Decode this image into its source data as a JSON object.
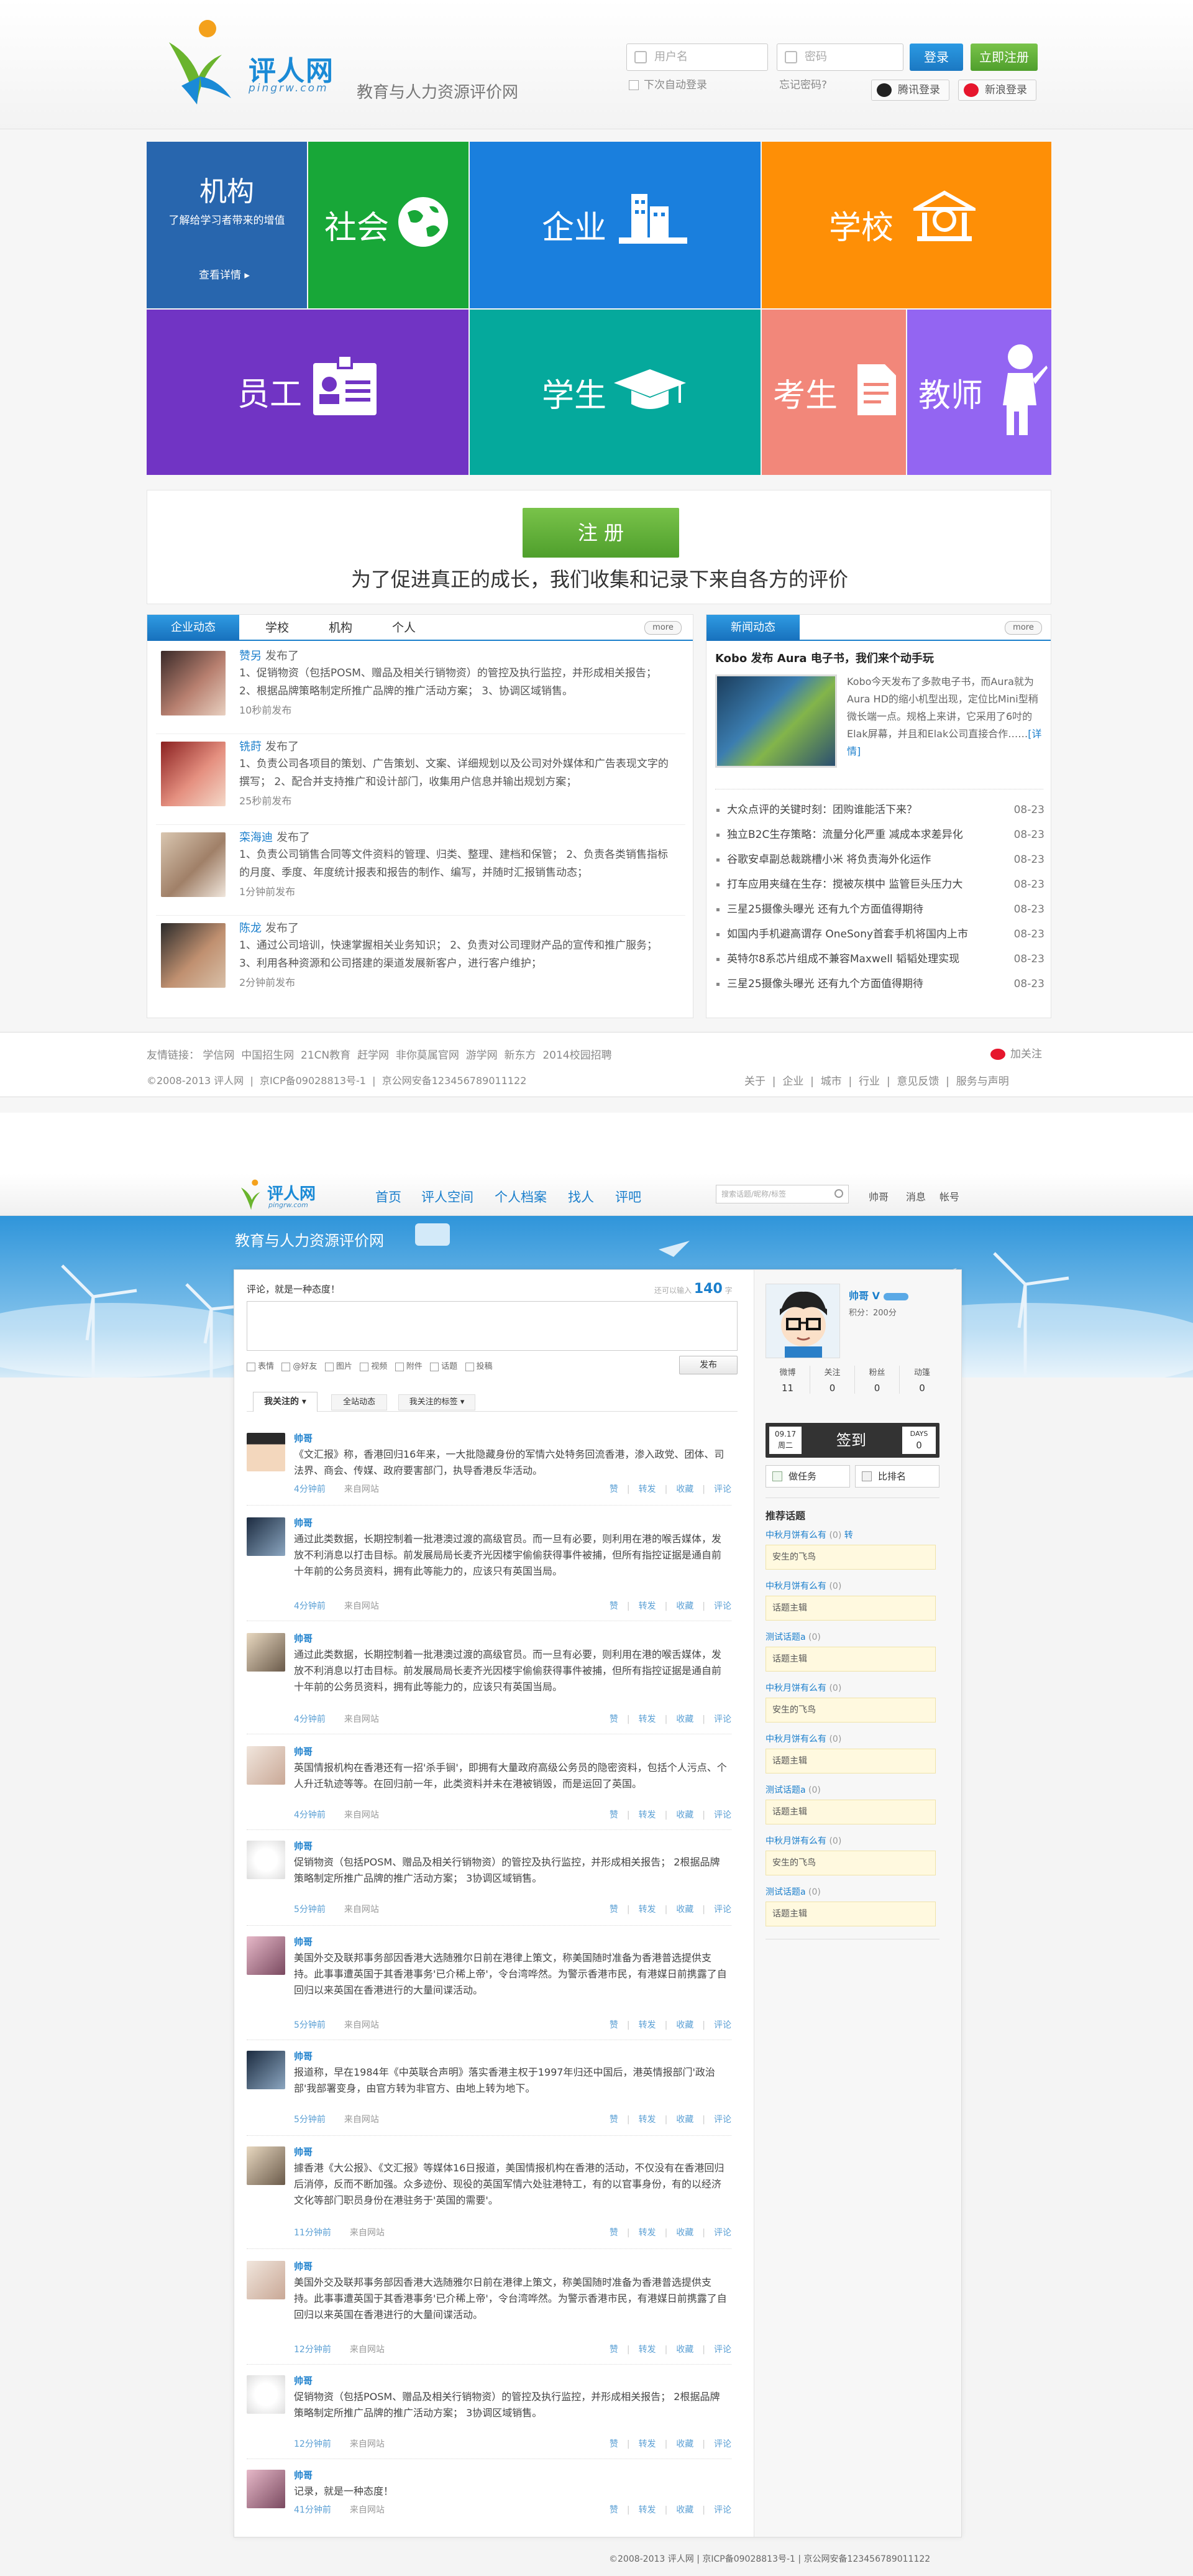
{
  "page1": {
    "brand": {
      "name": "评人网",
      "domain": "pingrw.com",
      "tagline": "教育与人力资源评价网"
    },
    "login": {
      "username_placeholder": "用户名",
      "password_placeholder": "密码",
      "login_btn": "登录",
      "register_btn": "立即注册",
      "auto_login": "下次自动登录",
      "forgot": "忘记密码?",
      "qq_login": "腾讯登录",
      "weibo_login": "新浪登录"
    },
    "tiles": {
      "org_title": "机构",
      "org_desc": "了解给学习者带来的增值",
      "org_link": "查看详情",
      "society": "社会",
      "enterprise": "企业",
      "school": "学校",
      "staff": "员工",
      "student": "学生",
      "examinee": "考生",
      "teacher": "教师"
    },
    "register": {
      "btn": "注 册",
      "slogan": "为了促进真正的成长，我们收集和记录下来自各方的评价"
    },
    "left_panel": {
      "tabs": [
        "企业动态",
        "学校",
        "机构",
        "个人"
      ],
      "more": "more",
      "feeds": [
        {
          "name": "赞另",
          "action": "发布了",
          "text": "1、促销物资（包括POSM、赠品及相关行销物资）的管控及执行监控，并形成相关报告；  2、根据品牌策略制定所推广品牌的推广活动方案； 3、协调区域销售。",
          "time": "10秒前发布"
        },
        {
          "name": "铣莳",
          "action": "发布了",
          "text": "1、负责公司各项目的策划、广告策划、文案、详细规划以及公司对外媒体和广告表现文字的撰写；  2、配合并支持推广和设计部门，收集用户信息并输出规划方案；",
          "time": "25秒前发布"
        },
        {
          "name": "栾海迪",
          "action": "发布了",
          "text": "1、负责公司销售合同等文件资料的管理、归类、整理、建档和保管；  2、负责各类销售指标的月度、季度、年度统计报表和报告的制作、编写，并随时汇报销售动态；",
          "time": "1分钟前发布"
        },
        {
          "name": "陈龙",
          "action": "发布了",
          "text": "1、通过公司培训，快速掌握相关业务知识；  2、负责对公司理财产品的宣传和推广服务；  3、利用各种资源和公司搭建的渠道发展新客户，进行客户维护；",
          "time": "2分钟前发布"
        }
      ]
    },
    "right_panel": {
      "tab": "新闻动态",
      "more": "more",
      "headline": "Kobo 发布 Aura 电子书，我们来个动手玩",
      "headline_text": "Kobo今天发布了多款电子书，而Aura就为Aura HD的缩小机型出现，定位比Mini型稍微长端一点。规格上来讲，它采用了6吋的Elak屏幕，并且和Elak公司直接合作……",
      "detail_link": "[详情]",
      "news": [
        {
          "title": "大众点评的关键时刻：团购谁能活下来？",
          "date": "08-23"
        },
        {
          "title": "独立B2C生存策略：流量分化严重 减成本求差异化",
          "date": "08-23"
        },
        {
          "title": "谷歌安卓副总裁跳槽小米 将负责海外化运作",
          "date": "08-23"
        },
        {
          "title": "打车应用夹缝在生存：搅被灰棋中 监管巨头压力大",
          "date": "08-23"
        },
        {
          "title": "三星25摄像头曝光 还有九个方面值得期待",
          "date": "08-23"
        },
        {
          "title": "如国内手机避高谓存 OneSony首套手机将国内上市",
          "date": "08-23"
        },
        {
          "title": "英特尔8系芯片组成不兼容Maxwell 韬韬处理实现",
          "date": "08-23"
        },
        {
          "title": "三星25摄像头曝光 还有九个方面值得期待",
          "date": "08-23"
        }
      ]
    },
    "footer": {
      "links_label": "友情链接：",
      "links": [
        "学信网",
        "中国招生网",
        "21CN教育",
        "赶学网",
        "非你莫属官网",
        "游学网",
        "新东方",
        "2014校园招聘"
      ],
      "follow": "加关注",
      "copyright": "©2008-2013 评人网",
      "icp": "京ICP备09028813号-1",
      "police": "京公网安备123456789011122",
      "nav": [
        "关于",
        "企业",
        "城市",
        "行业",
        "意见反馈",
        "服务与声明"
      ]
    }
  },
  "page2": {
    "brand": {
      "name": "评人网",
      "domain": "pingrw.com"
    },
    "nav": [
      "首页",
      "评人空间",
      "个人档案",
      "找人",
      "评吧"
    ],
    "search_placeholder": "搜索话题/昵称/标签",
    "user_links": [
      "帅哥",
      "消息",
      "帐号"
    ],
    "banner_title": "教育与人力资源评价网",
    "composer": {
      "prompt": "评论，就是一种态度！",
      "limit_label": "还可以输入",
      "limit_value": "140",
      "limit_unit": "字",
      "tools": [
        "表情",
        "@好友",
        "图片",
        "视频",
        "附件",
        "话题",
        "投稿"
      ],
      "publish": "发布"
    },
    "filters": [
      "我关注的",
      "全站动态",
      "我关注的标签"
    ],
    "posts": [
      {
        "name": "帅哥",
        "text": "《文汇报》称，香港回归16年来，一大批隐藏身份的军情六处特务回流香港，渗入政党、团体、司法界、商会、传媒、政府要害部门，执导香港反华活动。",
        "time": "4分钟前",
        "source": "来自网站"
      },
      {
        "name": "帅哥",
        "text": "通过此类数据，长期控制着一批港澳过渡的高级官员。而一旦有必要，则利用在港的喉舌媒体，发放不利消息以打击目标。前发展局局长麦齐光因楼宇偷偷获得事件被捕，但所有指控证据是通自前十年前的公务员资料，拥有此等能力的，应该只有英国当局。",
        "time": "4分钟前",
        "source": "来自网站"
      },
      {
        "name": "帅哥",
        "text": "通过此类数据，长期控制着一批港澳过渡的高级官员。而一旦有必要，则利用在港的喉舌媒体，发放不利消息以打击目标。前发展局局长麦齐光因楼宇偷偷获得事件被捕，但所有指控证据是通自前十年前的公务员资料，拥有此等能力的，应该只有英国当局。",
        "time": "4分钟前",
        "source": "来自网站"
      },
      {
        "name": "帅哥",
        "text": "英国情报机构在香港还有一招'杀手锏'，即拥有大量政府高级公务员的隐密资料，包括个人污点、个人升迁轨迹等等。在回归前一年，此类资料并未在港被销毁，而是运回了英国。",
        "time": "4分钟前",
        "source": "来自网站"
      },
      {
        "name": "帅哥",
        "text": "促销物资（包括POSM、赠品及相关行销物资）的管控及执行监控，并形成相关报告；  2根据品牌策略制定所推广品牌的推广活动方案； 3协调区域销售。",
        "time": "5分钟前",
        "source": "来自网站"
      },
      {
        "name": "帅哥",
        "text": "美国外交及联邦事务部因香港大选随雅尔日前在港律上策文，称美国随时准备为香港普选提供支持。此事事遭英国于其香港事务'已介稀上帝'，令台湾哗然。为警示香港市民，有港媒日前携露了自回归以来英国在香港进行的大量间谍活动。",
        "time": "5分钟前",
        "source": "来自网站"
      },
      {
        "name": "帅哥",
        "text": "报道称，早在1984年《中英联合声明》落实香港主权于1997年归还中国后，港英情报部门'政治部'我部署变身，由官方转为非官方、由地上转为地下。",
        "time": "5分钟前",
        "source": "来自网站"
      },
      {
        "name": "帅哥",
        "text": "據香港《大公报》、《文汇报》等媒体16日报道，美国情报机构在香港的活动，不仅没有在香港回归后消停，反而不断加强。众多迹份、现役的英国军情六处驻港特工，有的以官事身份，有的以经济文化等部门职员身份在港驻务于'英国的需要'。",
        "time": "11分钟前",
        "source": "来自网站"
      },
      {
        "name": "帅哥",
        "text": "美国外交及联邦事务部因香港大选随雅尔日前在港律上策文，称美国随时准备为香港普选提供支持。此事事遭英国于其香港事务'已介稀上帝'，令台湾哗然。为警示香港市民，有港媒日前携露了自回归以来英国在香港进行的大量间谍活动。",
        "time": "12分钟前",
        "source": "来自网站"
      },
      {
        "name": "帅哥",
        "text": "促销物资（包括POSM、赠品及相关行销物资）的管控及执行监控，并形成相关报告；  2根据品牌策略制定所推广品牌的推广活动方案； 3协调区域销售。",
        "time": "12分钟前",
        "source": "来自网站"
      },
      {
        "name": "帅哥",
        "text": "记录，就是一种态度！",
        "time": "41分钟前",
        "source": "来自网站"
      }
    ],
    "post_ops": [
      "赞",
      "转发",
      "收藏",
      "评论"
    ],
    "profile": {
      "name": "帅哥",
      "badge": "V",
      "score": "积分：200分",
      "stats": [
        {
          "label": "微博",
          "value": "11"
        },
        {
          "label": "关注",
          "value": "0"
        },
        {
          "label": "粉丝",
          "value": "0"
        },
        {
          "label": "动篷",
          "value": "0"
        }
      ],
      "checkin_date": "09.17",
      "checkin_week": "周二",
      "checkin_label": "签到",
      "days_label": "DAYS",
      "days_value": "0",
      "task_label": "做任务",
      "compare_label": "比排名",
      "topics_title": "推荐话题",
      "topics": [
        {
          "title": "中秋月饼有么有",
          "count": "(0)",
          "tag": "转",
          "box": "安生的飞鸟"
        },
        {
          "title": "中秋月饼有么有",
          "count": "(0)",
          "tag": "",
          "box": "话题主辑"
        },
        {
          "title": "测试话题a",
          "count": "(0)",
          "tag": "",
          "box": "话题主辑"
        },
        {
          "title": "中秋月饼有么有",
          "count": "(0)",
          "tag": "",
          "box": "安生的飞鸟"
        },
        {
          "title": "中秋月饼有么有",
          "count": "(0)",
          "tag": "",
          "box": "话题主辑"
        },
        {
          "title": "测试话题a",
          "count": "(0)",
          "tag": "",
          "box": "话题主辑"
        },
        {
          "title": "中秋月饼有么有",
          "count": "(0)",
          "tag": "",
          "box": "安生的飞鸟"
        },
        {
          "title": "测试话题a",
          "count": "(0)",
          "tag": "",
          "box": "话题主辑"
        }
      ]
    },
    "footer": "©2008-2013 评人网  |  京ICP备09028813号-1  |  京公网安备123456789011122"
  }
}
